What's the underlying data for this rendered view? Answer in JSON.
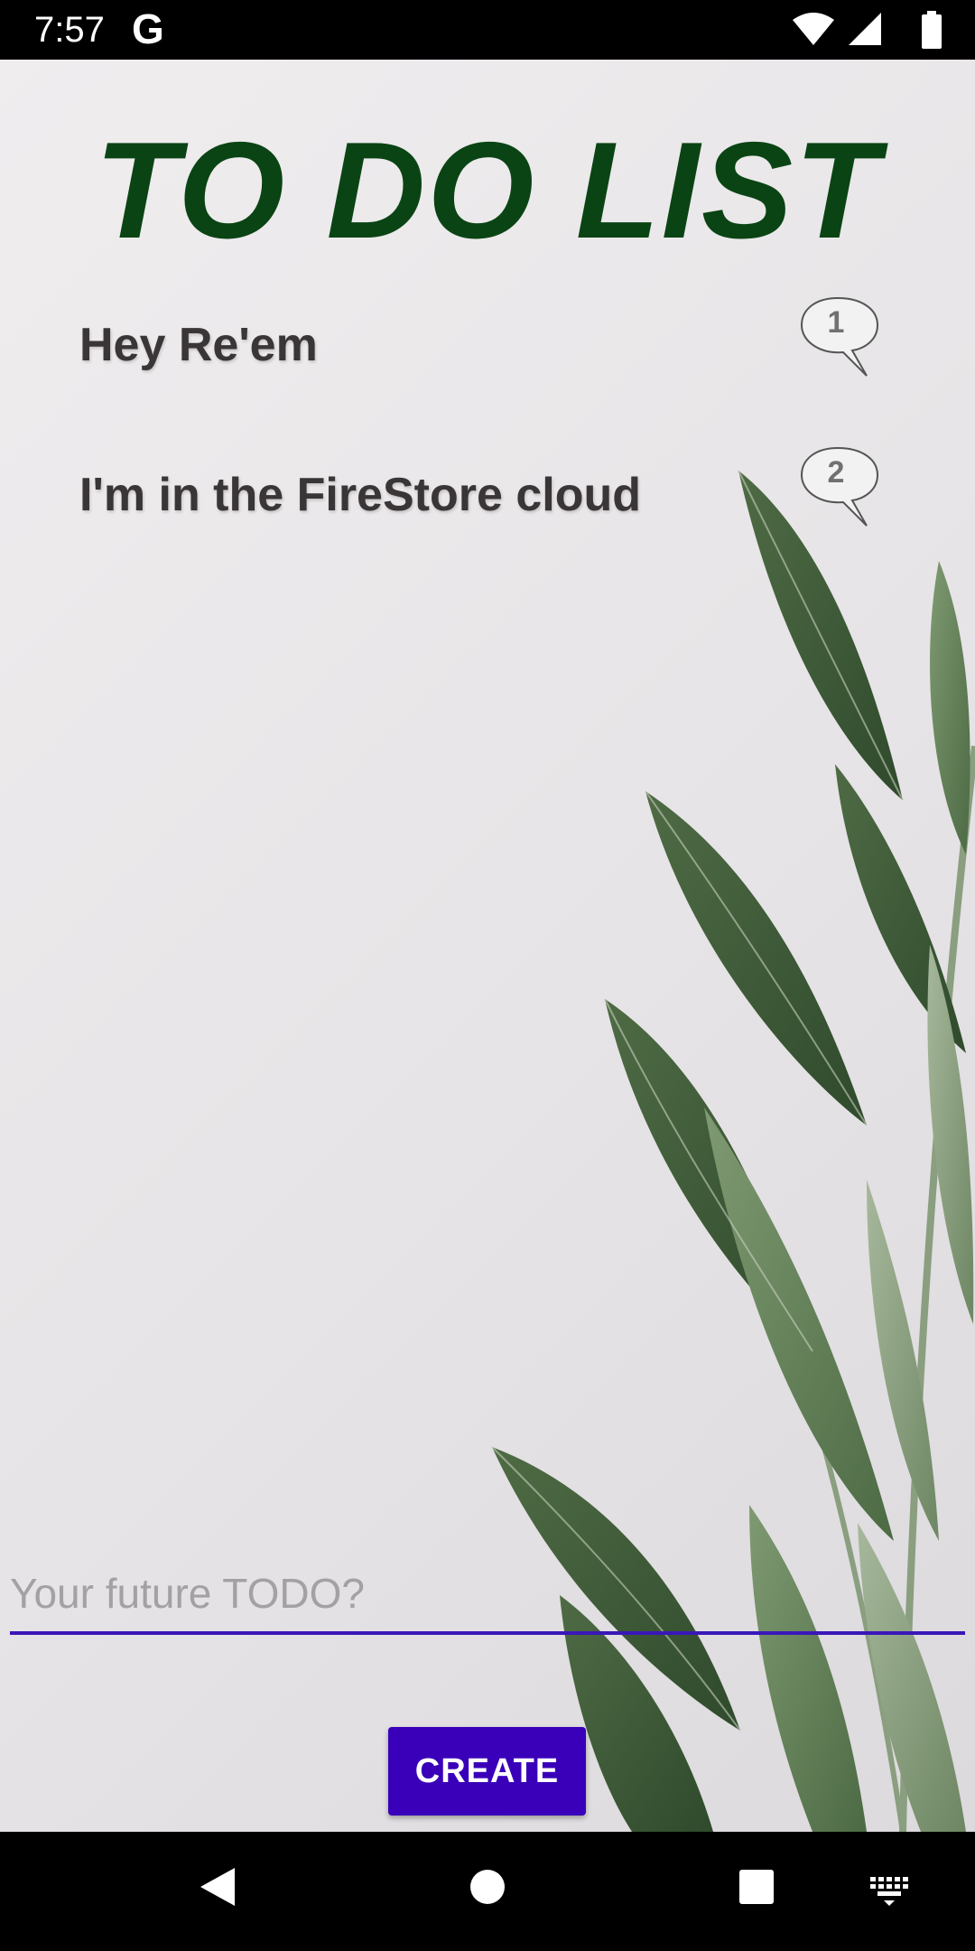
{
  "status_bar": {
    "time": "7:57",
    "google_icon_letter": "G",
    "icons": [
      "wifi-icon",
      "cell-signal-icon",
      "battery-icon"
    ]
  },
  "app": {
    "title": "TO DO LIST",
    "title_color": "#0a4414",
    "todos": [
      {
        "text": "Hey Re'em",
        "badge": "1"
      },
      {
        "text": "I'm in the FireStore cloud",
        "badge": "2"
      }
    ],
    "input": {
      "value": "",
      "placeholder": "Your future TODO?"
    },
    "create_label": "CREATE",
    "accent_color": "#3a00b9",
    "background_image": "green-leaves-photo"
  },
  "nav_bar": {
    "icons": [
      "back-icon",
      "home-icon",
      "recents-icon",
      "keyboard-icon"
    ]
  }
}
